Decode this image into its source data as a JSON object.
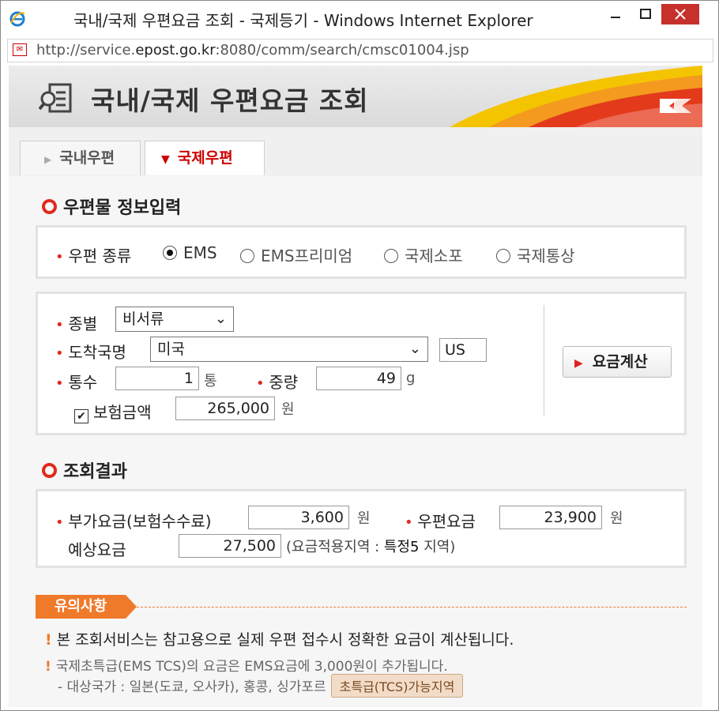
{
  "window": {
    "title": "국내/국제 우편요금 조회 - 국제등기 - Windows Internet Explorer",
    "url_prefix": "http://service.",
    "url_domain": "epost.go.kr",
    "url_suffix": ":8080/comm/search/cmsc01004.jsp"
  },
  "header": {
    "title": "국내/국제 우편요금 조회"
  },
  "tabs": [
    {
      "label": "국내우편",
      "active": false
    },
    {
      "label": "국제우편",
      "active": true
    }
  ],
  "input_section": {
    "title": "우편물 정보입력",
    "mail_type_label": "우편 종류",
    "mail_types": [
      {
        "label": "EMS",
        "selected": true
      },
      {
        "label": "EMS프리미엄",
        "selected": false
      },
      {
        "label": "국제소포",
        "selected": false
      },
      {
        "label": "국제통상",
        "selected": false
      }
    ],
    "category_label": "종별",
    "category_value": "비서류",
    "country_label": "도착국명",
    "country_value": "미국",
    "country_code": "US",
    "count_label": "통수",
    "count_value": "1",
    "count_unit": "통",
    "weight_label": "중량",
    "weight_value": "49",
    "weight_unit": "g",
    "insurance_label": "보험금액",
    "insurance_checked": true,
    "insurance_value": "265,000",
    "insurance_unit": "원",
    "calc_button": "요금계산"
  },
  "result_section": {
    "title": "조회결과",
    "surcharge_label": "부가요금(보험수수료)",
    "surcharge_value": "3,600",
    "surcharge_unit": "원",
    "postage_label": "우편요금",
    "postage_value": "23,900",
    "postage_unit": "원",
    "estimate_label": "예상요금",
    "estimate_value": "27,500",
    "estimate_note_prefix": "(요금적용지역 : ",
    "estimate_note_zone": "특정5",
    "estimate_note_suffix": " 지역)"
  },
  "notice": {
    "tag": "유의사항",
    "line1": "본 조회서비스는 참고용으로 실제 우편 접수시 정확한 요금이 계산됩니다.",
    "line2": "국제초특급(EMS TCS)의 요금은 EMS요금에 3,000원이 추가됩니다.",
    "line3": "- 대상국가 : 일본(도쿄, 오사카), 홍콩, 싱가포르",
    "tcs_button": "초특급(TCS)가능지역"
  },
  "colors": {
    "accent": "#e02a1d",
    "orange": "#ef7a2a",
    "close": "#c7312b"
  }
}
